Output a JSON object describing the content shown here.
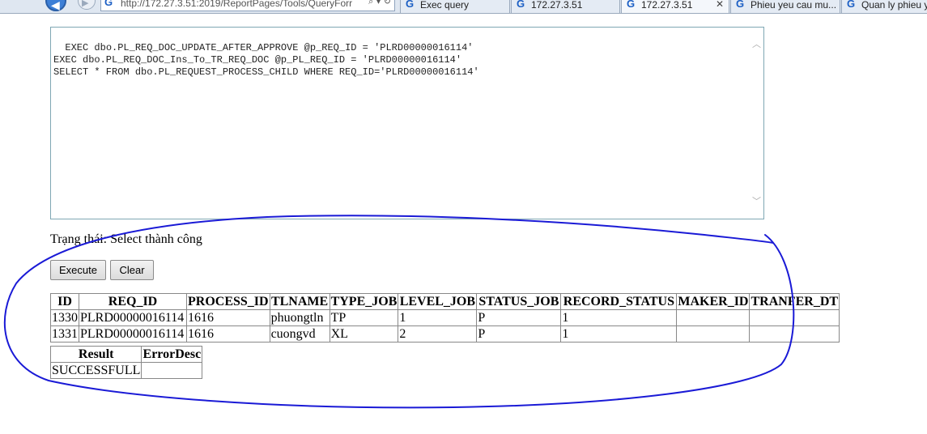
{
  "browser": {
    "address_url": "http://172.27.3.51:2019/ReportPages/Tools/QueryForr",
    "address_icons": "⌕ ▾ ↻",
    "tabs": [
      {
        "label": "Exec query",
        "active": false
      },
      {
        "label": "172.27.3.51",
        "active": false
      },
      {
        "label": "172.27.3.51",
        "active": true
      },
      {
        "label": "Phieu yeu cau mu...",
        "active": false
      },
      {
        "label": "Quan ly phieu y",
        "active": false
      }
    ]
  },
  "query": {
    "text": "EXEC dbo.PL_REQ_DOC_UPDATE_AFTER_APPROVE @p_REQ_ID = 'PLRD00000016114'\nEXEC dbo.PL_REQ_DOC_Ins_To_TR_REQ_DOC @p_PL_REQ_ID = 'PLRD00000016114'\nSELECT * FROM dbo.PL_REQUEST_PROCESS_CHILD WHERE REQ_ID='PLRD00000016114'"
  },
  "status": {
    "text": "Trạng thái: Select thành công"
  },
  "buttons": {
    "execute": "Execute",
    "clear": "Clear"
  },
  "result_table": {
    "columns": [
      "ID",
      "REQ_ID",
      "PROCESS_ID",
      "TLNAME",
      "TYPE_JOB",
      "LEVEL_JOB",
      "STATUS_JOB",
      "RECORD_STATUS",
      "MAKER_ID",
      "TRANFER_DT"
    ],
    "rows": [
      [
        "1330",
        "PLRD00000016114",
        "1616",
        "phuongtln",
        "TP",
        "1",
        "P",
        "1",
        "",
        ""
      ],
      [
        "1331",
        "PLRD00000016114",
        "1616",
        "cuongvd",
        "XL",
        "2",
        "P",
        "1",
        "",
        ""
      ]
    ]
  },
  "status_table": {
    "columns": [
      "Result",
      "ErrorDesc"
    ],
    "rows": [
      [
        "SUCCESSFULL",
        ""
      ]
    ]
  },
  "colors": {
    "annotation_stroke": "#1a1ad6",
    "textarea_border": "#7fa7b4"
  }
}
